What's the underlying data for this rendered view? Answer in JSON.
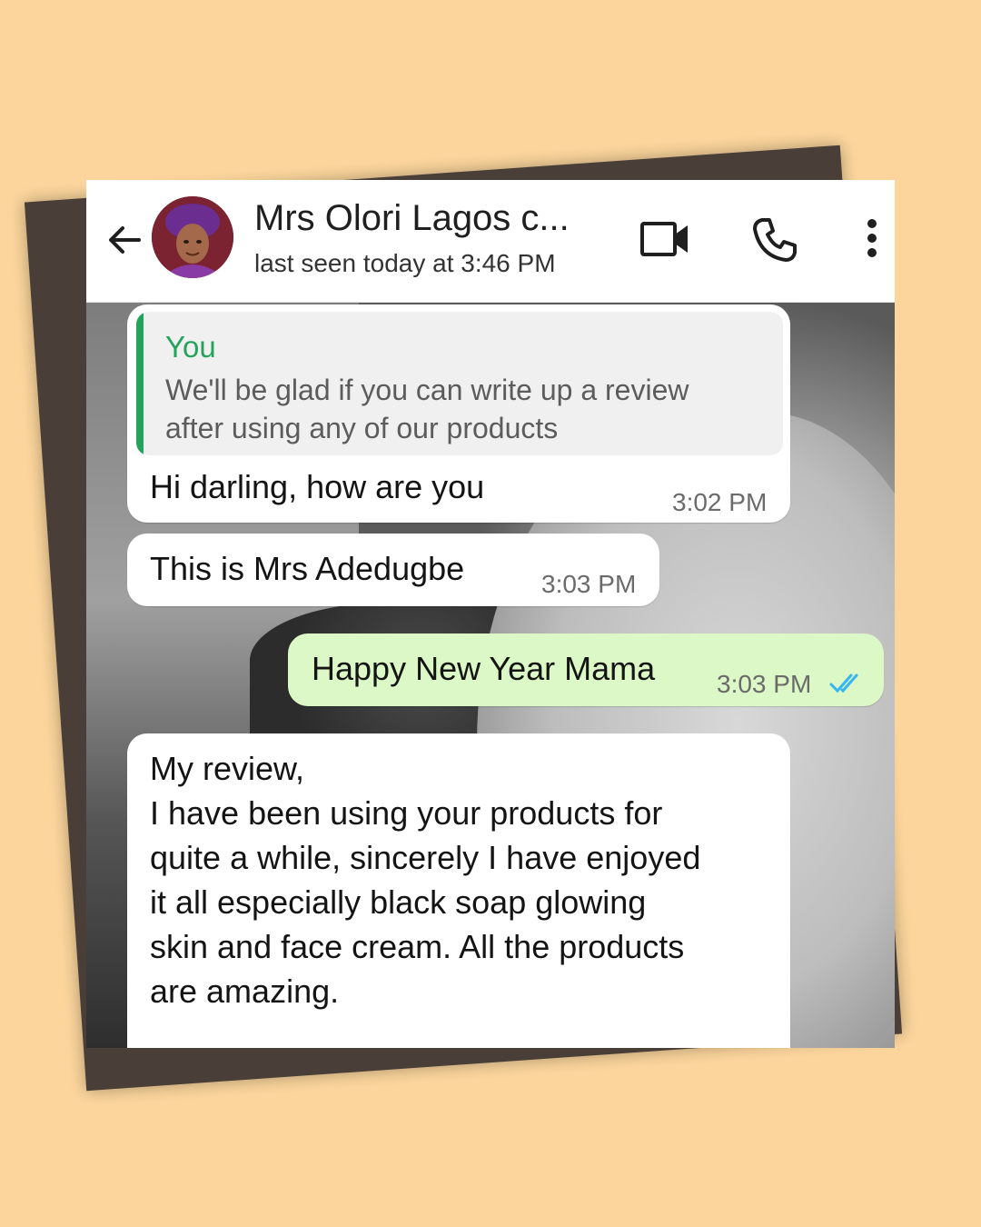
{
  "header": {
    "contact_name": "Mrs Olori Lagos c...",
    "status": "last seen today at 3:46 PM",
    "icons": [
      "back-arrow-icon",
      "avatar",
      "video-call-icon",
      "phone-icon",
      "more-vert-icon"
    ]
  },
  "messages": [
    {
      "direction": "incoming",
      "quote_author": "You",
      "quote_lines": [
        "We'll be glad if you can write up a review",
        "after using any of our products"
      ],
      "text": "Hi darling, how are you",
      "time": "3:02 PM"
    },
    {
      "direction": "incoming",
      "text": "This is Mrs Adedugbe",
      "time": "3:03 PM"
    },
    {
      "direction": "outgoing",
      "text": "Happy New Year Mama",
      "time": "3:03 PM",
      "status_icon": "double-check-icon"
    },
    {
      "direction": "incoming",
      "lines": [
        "My review,",
        "I have been using your products for",
        "quite a while, sincerely I have enjoyed",
        "it all especially black  soap glowing",
        "skin and face cream. All the products",
        "are amazing."
      ]
    }
  ],
  "colors": {
    "page_background": "#fbd59c",
    "outgoing_bubble": "#dcf8c6",
    "quote_accent": "#25a35a",
    "read_receipt": "#34b7f1"
  }
}
